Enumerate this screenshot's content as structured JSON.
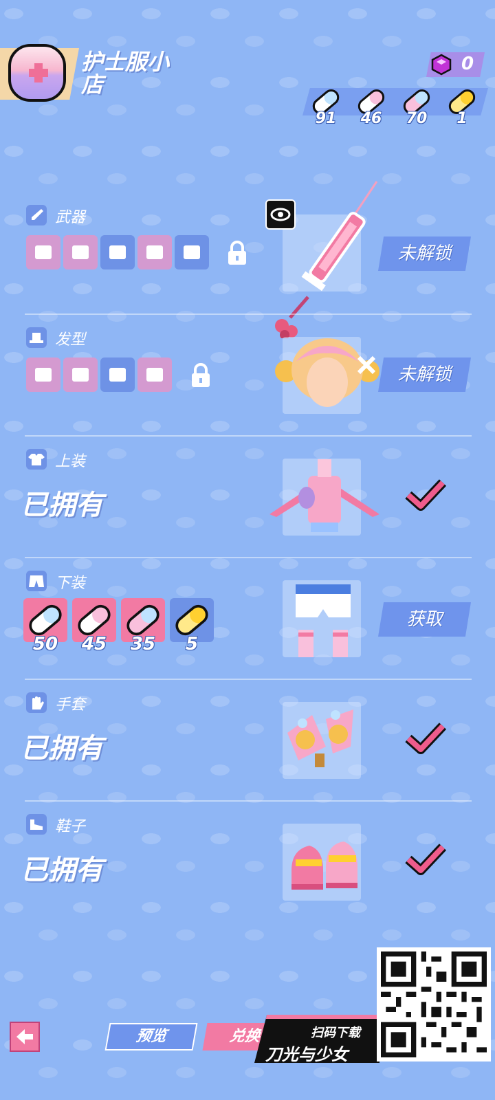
{
  "shop": {
    "title": "护士服小店",
    "icon": "nurse-cross-icon"
  },
  "currency": {
    "gem_count": "0",
    "pills": [
      {
        "name": "blue-pill",
        "count": "91",
        "color": "#bfe3ff"
      },
      {
        "name": "pink-pill",
        "count": "46",
        "color": "#f9c0dc"
      },
      {
        "name": "pink-blue-pill",
        "count": "70",
        "color": "#c9d8ff"
      },
      {
        "name": "gold-pill",
        "count": "1",
        "color": "#ffd94a"
      }
    ]
  },
  "rows": [
    {
      "key": "weapon",
      "label": "武器",
      "status": "未解锁",
      "status_type": "locked",
      "icon": "sword-icon"
    },
    {
      "key": "hair",
      "label": "发型",
      "status": "未解锁",
      "status_type": "locked",
      "icon": "hat-icon"
    },
    {
      "key": "top",
      "label": "上装",
      "owned_text": "已拥有",
      "status_type": "owned",
      "icon": "shirt-icon"
    },
    {
      "key": "bottom",
      "label": "下装",
      "status": "获取",
      "status_type": "buy",
      "icon": "shorts-icon",
      "prices": [
        "50",
        "45",
        "35",
        "5"
      ]
    },
    {
      "key": "gloves",
      "label": "手套",
      "owned_text": "已拥有",
      "status_type": "owned",
      "icon": "glove-icon"
    },
    {
      "key": "shoes",
      "label": "鞋子",
      "owned_text": "已拥有",
      "status_type": "owned",
      "icon": "shoe-icon"
    }
  ],
  "bottom": {
    "preview_label": "预览",
    "exchange_label": "兑换",
    "promo_top": "扫码下载",
    "promo_main": "刀光与少女"
  },
  "colors": {
    "bg": "#8fb6f5",
    "accent_pink": "#f27aa3",
    "accent_blue": "#6f94ec"
  }
}
